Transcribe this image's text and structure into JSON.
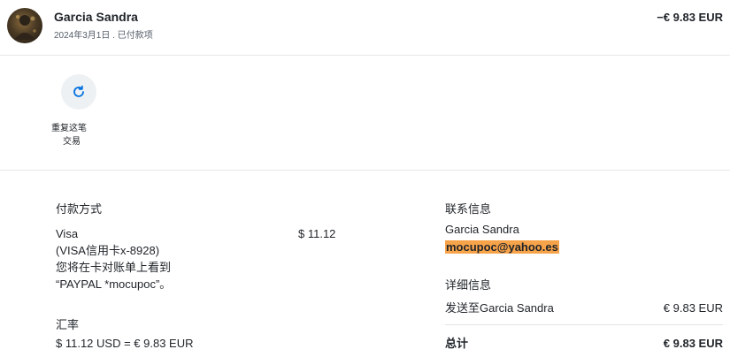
{
  "header": {
    "name": "Garcia Sandra",
    "subline": "2024年3月1日 . 已付款项",
    "amount": "−€ 9.83 EUR"
  },
  "actions": {
    "repeat_line1": "重复这笔",
    "repeat_line2": "交易"
  },
  "payment": {
    "title": "付款方式",
    "method_line1": "Visa",
    "method_line2": "(VISA信用卡x-8928)",
    "method_line3": "您将在卡对账单上看到",
    "method_line4": "“PAYPAL *mocupoc”。",
    "amount": "$ 11.12"
  },
  "exchange": {
    "title": "汇率",
    "conversion": "$ 11.12 USD = € 9.83 EUR"
  },
  "contact": {
    "title": "联系信息",
    "name": "Garcia Sandra",
    "email": "mocupoc@yahoo.es"
  },
  "details": {
    "title": "详细信息",
    "ship_to_label": "发送至Garcia Sandra",
    "ship_to_amount": "€ 9.83 EUR",
    "total_label": "总计",
    "total_amount": "€ 9.83 EUR"
  },
  "colors": {
    "highlight": "#f7a34a",
    "icon_blue": "#0070e0"
  }
}
